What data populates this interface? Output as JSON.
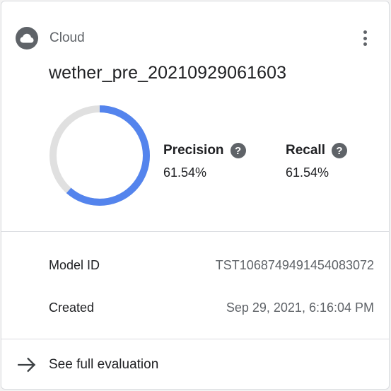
{
  "card": {
    "source": {
      "icon": "cloud-icon",
      "label": "Cloud"
    },
    "menu_icon": "more-vert-icon",
    "model_name": "wether_pre_20210929061603",
    "evaluation": {
      "donut_fraction": 0.6154,
      "colors": {
        "filled": "#5484ed",
        "track": "#e0e0e0"
      },
      "precision": {
        "label": "Precision",
        "value": "61.54%",
        "help_icon": "help-icon"
      },
      "recall": {
        "label": "Recall",
        "value": "61.54%",
        "help_icon": "help-icon"
      }
    },
    "details": [
      {
        "label": "Model ID",
        "value": "TST1068749491454083072"
      },
      {
        "label": "Created",
        "value": "Sep 29, 2021, 6:16:04 PM"
      }
    ],
    "footer": {
      "icon": "arrow-forward-icon",
      "label": "See full evaluation"
    }
  }
}
